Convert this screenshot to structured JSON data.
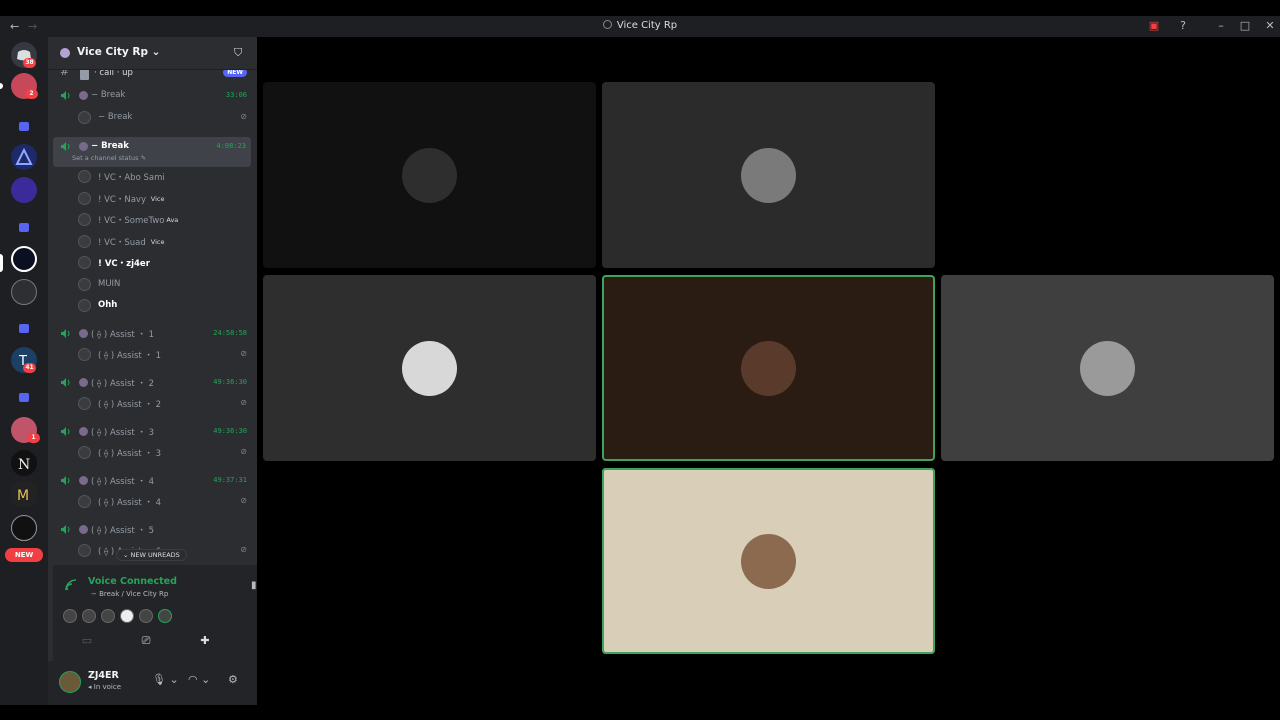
{
  "titlebar": {
    "title": "Vice City Rp",
    "back": "←",
    "forward": "→"
  },
  "rail": {
    "dm_badge": "38",
    "server_badges": [
      "2",
      "41",
      "1"
    ],
    "new_label": "NEW"
  },
  "guild": {
    "name": "Vice City Rp"
  },
  "channels": [
    {
      "type": "text",
      "label": "· call · up",
      "tag": "NEW"
    },
    {
      "type": "voice",
      "label": "− Break",
      "time": "33:06"
    },
    {
      "type": "member",
      "label": "− Break"
    },
    {
      "type": "voice-selected",
      "label": "− Break",
      "time": "4:08:23",
      "status": "Set a channel status"
    },
    {
      "type": "member",
      "label": "! VC・Abo Sami"
    },
    {
      "type": "member",
      "label": "! VC・Navy",
      "tag": "Vice"
    },
    {
      "type": "member",
      "label": "! VC・SomeTwo",
      "tag": "Ava"
    },
    {
      "type": "member",
      "label": "! VC・Suad",
      "tag": "Vice"
    },
    {
      "type": "member-bright",
      "label": "! VC・zj4er"
    },
    {
      "type": "member",
      "label": "MUIN"
    },
    {
      "type": "member-bright",
      "label": "Ohh"
    },
    {
      "type": "voice",
      "label": "( ⟠ ) Assist ・ 1",
      "time": "24:58:58"
    },
    {
      "type": "member",
      "label": "( ⟠ ) Assist ・ 1"
    },
    {
      "type": "voice",
      "label": "( ⟠ ) Assist ・ 2",
      "time": "49:36:30"
    },
    {
      "type": "member",
      "label": "( ⟠ ) Assist ・ 2"
    },
    {
      "type": "voice",
      "label": "( ⟠ ) Assist ・ 3",
      "time": "49:36:30"
    },
    {
      "type": "member",
      "label": "( ⟠ ) Assist ・ 3"
    },
    {
      "type": "voice",
      "label": "( ⟠ ) Assist ・ 4",
      "time": "49:37:31"
    },
    {
      "type": "member",
      "label": "( ⟠ ) Assist ・ 4"
    },
    {
      "type": "voice",
      "label": "( ⟠ ) Assist ・ 5"
    },
    {
      "type": "member",
      "label": "( ⟠ ) Assist ・ 6"
    }
  ],
  "new_unreads": "NEW UNREADS",
  "voice": {
    "status": "Voice Connected",
    "location": "− Break / Vice City Rp"
  },
  "user": {
    "name": "ZJ4ER",
    "status": "In voice"
  },
  "tiles": [
    {
      "bg": "#111111",
      "avatar": "#2e2e2e",
      "speaking": false
    },
    {
      "bg": "#2b2b2b",
      "avatar": "#7a7a7a",
      "speaking": false
    },
    {
      "bg": "#000000",
      "avatar": "#000000",
      "speaking": false
    },
    {
      "bg": "#2e2e2e",
      "avatar": "#d8d8d8",
      "speaking": false
    },
    {
      "bg": "#2a1c12",
      "avatar": "#5a3a2a",
      "speaking": true
    },
    {
      "bg": "#3f3f3f",
      "avatar": "#9a9a9a",
      "speaking": false
    },
    {
      "bg": "#d9cfb8",
      "avatar": "#8b6a4f",
      "speaking": true
    }
  ],
  "colors": {
    "speaking": "#3ba55c",
    "voice_green": "#23a559",
    "blurple": "#5865f2",
    "danger": "#f23f43"
  }
}
